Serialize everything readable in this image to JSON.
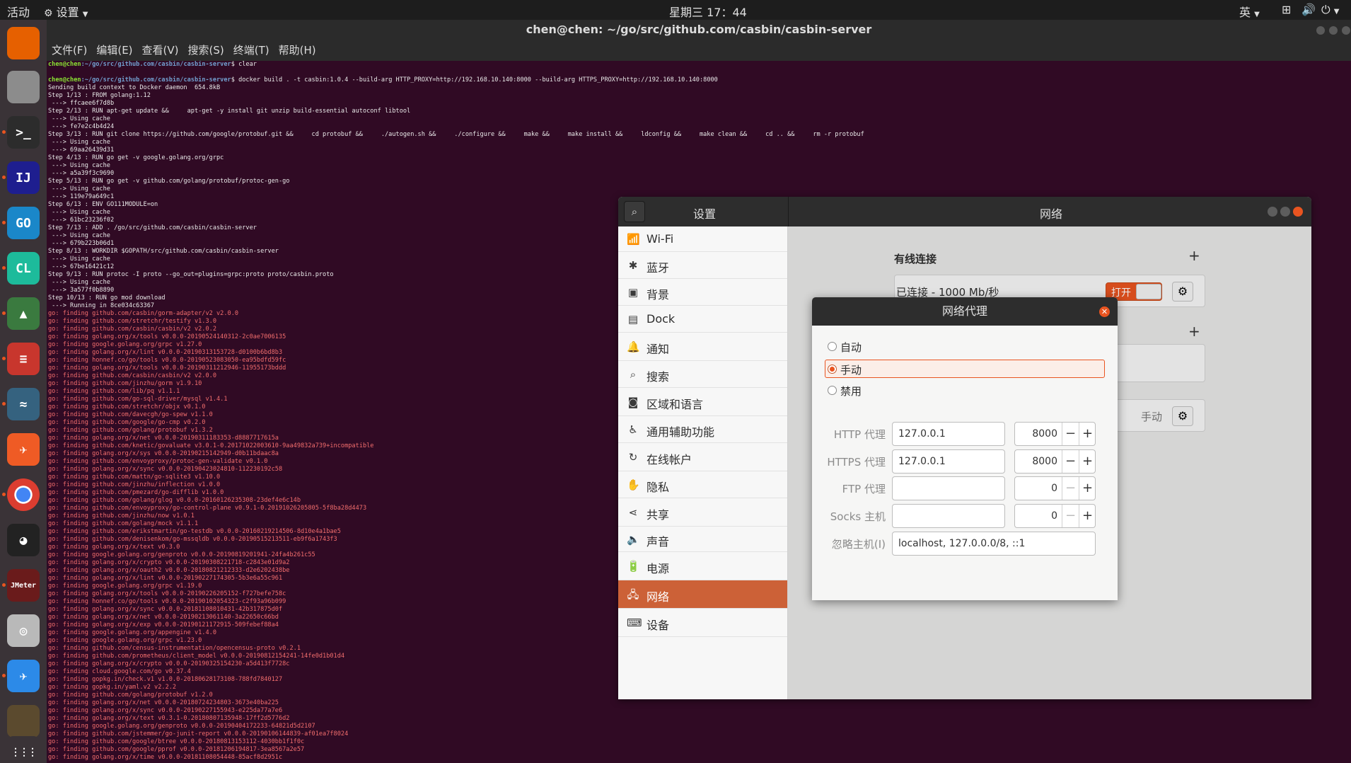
{
  "topbar": {
    "activities": "活动",
    "app": "设置",
    "clock": "星期三 17：44",
    "lang": "英"
  },
  "dock": {
    "items": [
      {
        "name": "firefox-icon",
        "color": "#e66000",
        "glyph": ""
      },
      {
        "name": "files-icon",
        "color": "#8c8c8c",
        "glyph": ""
      },
      {
        "name": "terminal-icon",
        "color": "#2c2c2c",
        "glyph": ">_"
      },
      {
        "name": "intellij-icon",
        "color": "#1e1e8f",
        "glyph": "IJ"
      },
      {
        "name": "goland-icon",
        "color": "#1a87c9",
        "glyph": "GO"
      },
      {
        "name": "clion-icon",
        "color": "#1dbb9b",
        "glyph": "CL"
      },
      {
        "name": "rocket-icon",
        "color": "#3a7a3f",
        "glyph": "▲"
      },
      {
        "name": "redis-icon",
        "color": "#c8362d",
        "glyph": "≡"
      },
      {
        "name": "mysql-workbench-icon",
        "color": "#35627f",
        "glyph": "≈"
      },
      {
        "name": "postman-icon",
        "color": "#ef5b25",
        "glyph": "✈"
      },
      {
        "name": "chrome-icon",
        "color": "#dc3d30",
        "glyph": "●"
      },
      {
        "name": "qq-icon",
        "color": "#222222",
        "glyph": "◕"
      },
      {
        "name": "jmeter-icon",
        "color": "#6a1b1b",
        "glyph": "JMeter"
      },
      {
        "name": "screenshot-icon",
        "color": "#b9b9b9",
        "glyph": "◎"
      },
      {
        "name": "deepin-icon",
        "color": "#2c8ae8",
        "glyph": "✈"
      },
      {
        "name": "notes-icon",
        "color": "#5b4a2e",
        "glyph": ""
      },
      {
        "name": "show-apps-icon",
        "color": "#3a3337",
        "glyph": "⋮⋮⋮"
      }
    ]
  },
  "terminal": {
    "title": "chen@chen: ~/go/src/github.com/casbin/casbin-server",
    "menu": [
      "文件(F)",
      "编辑(E)",
      "查看(V)",
      "搜索(S)",
      "终端(T)",
      "帮助(H)"
    ],
    "prompt_user": "chen@chen",
    "prompt_path": ":~/go/src/github.com/casbin/casbin-server",
    "lines": [
      {
        "t": "p",
        "cmd": "$ clear"
      },
      {
        "t": "b",
        "text": ""
      },
      {
        "t": "p",
        "cmd": "$ docker build . -t casbin:1.0.4 --build-arg HTTP_PROXY=http://192.168.10.140:8000 --build-arg HTTPS_PROXY=http://192.168.10.140:8000"
      },
      {
        "t": "n",
        "text": "Sending build context to Docker daemon  654.8kB"
      },
      {
        "t": "n",
        "text": "Step 1/13 : FROM golang:1.12"
      },
      {
        "t": "n",
        "text": " ---> ffcaee6f7d8b"
      },
      {
        "t": "n",
        "text": "Step 2/13 : RUN apt-get update &&     apt-get -y install git unzip build-essential autoconf libtool"
      },
      {
        "t": "n",
        "text": " ---> Using cache"
      },
      {
        "t": "n",
        "text": " ---> fe7e2c4b4d24"
      },
      {
        "t": "n",
        "text": "Step 3/13 : RUN git clone https://github.com/google/protobuf.git &&     cd protobuf &&     ./autogen.sh &&     ./configure &&     make &&     make install &&     ldconfig &&     make clean &&     cd .. &&     rm -r protobuf"
      },
      {
        "t": "n",
        "text": " ---> Using cache"
      },
      {
        "t": "n",
        "text": " ---> 69aa26439d31"
      },
      {
        "t": "n",
        "text": "Step 4/13 : RUN go get -v google.golang.org/grpc"
      },
      {
        "t": "n",
        "text": " ---> Using cache"
      },
      {
        "t": "n",
        "text": " ---> a5a39f3c9690"
      },
      {
        "t": "n",
        "text": "Step 5/13 : RUN go get -v github.com/golang/protobuf/protoc-gen-go"
      },
      {
        "t": "n",
        "text": " ---> Using cache"
      },
      {
        "t": "n",
        "text": " ---> 119e79a649c1"
      },
      {
        "t": "n",
        "text": "Step 6/13 : ENV GO111MODULE=on"
      },
      {
        "t": "n",
        "text": " ---> Using cache"
      },
      {
        "t": "n",
        "text": " ---> 61bc23236f02"
      },
      {
        "t": "n",
        "text": "Step 7/13 : ADD . /go/src/github.com/casbin/casbin-server"
      },
      {
        "t": "n",
        "text": " ---> Using cache"
      },
      {
        "t": "n",
        "text": " ---> 679b223b06d1"
      },
      {
        "t": "n",
        "text": "Step 8/13 : WORKDIR $GOPATH/src/github.com/casbin/casbin-server"
      },
      {
        "t": "n",
        "text": " ---> Using cache"
      },
      {
        "t": "n",
        "text": " ---> 67be16421c12"
      },
      {
        "t": "n",
        "text": "Step 9/13 : RUN protoc -I proto --go_out=plugins=grpc:proto proto/casbin.proto"
      },
      {
        "t": "n",
        "text": " ---> Using cache"
      },
      {
        "t": "n",
        "text": " ---> 3a577f0b8890"
      },
      {
        "t": "n",
        "text": "Step 10/13 : RUN go mod download"
      },
      {
        "t": "n",
        "text": " ---> Running in 8ce034c63367"
      },
      {
        "t": "g",
        "text": "go: finding github.com/casbin/gorm-adapter/v2 v2.0.0"
      },
      {
        "t": "g",
        "text": "go: finding github.com/stretchr/testify v1.3.0"
      },
      {
        "t": "g",
        "text": "go: finding github.com/casbin/casbin/v2 v2.0.2"
      },
      {
        "t": "g",
        "text": "go: finding golang.org/x/tools v0.0.0-20190524140312-2c0ae7006135"
      },
      {
        "t": "g",
        "text": "go: finding google.golang.org/grpc v1.27.0"
      },
      {
        "t": "g",
        "text": "go: finding golang.org/x/lint v0.0.0-20190313153728-d0100b6bd8b3"
      },
      {
        "t": "g",
        "text": "go: finding honnef.co/go/tools v0.0.0-20190523083050-ea95bdfd59fc"
      },
      {
        "t": "g",
        "text": "go: finding golang.org/x/tools v0.0.0-20190311212946-11955173bddd"
      },
      {
        "t": "g",
        "text": "go: finding github.com/casbin/casbin/v2 v2.0.0"
      },
      {
        "t": "g",
        "text": "go: finding github.com/jinzhu/gorm v1.9.10"
      },
      {
        "t": "g",
        "text": "go: finding github.com/lib/pq v1.1.1"
      },
      {
        "t": "g",
        "text": "go: finding github.com/go-sql-driver/mysql v1.4.1"
      },
      {
        "t": "g",
        "text": "go: finding github.com/stretchr/objx v0.1.0"
      },
      {
        "t": "g",
        "text": "go: finding github.com/davecgh/go-spew v1.1.0"
      },
      {
        "t": "g",
        "text": "go: finding github.com/google/go-cmp v0.2.0"
      },
      {
        "t": "g",
        "text": "go: finding github.com/golang/protobuf v1.3.2"
      },
      {
        "t": "g",
        "text": "go: finding golang.org/x/net v0.0.0-20190311183353-d8887717615a"
      },
      {
        "t": "g",
        "text": "go: finding github.com/knetic/govaluate v3.0.1-0.20171022003610-9aa49832a739+incompatible"
      },
      {
        "t": "g",
        "text": "go: finding golang.org/x/sys v0.0.0-20190215142949-d0b11bdaac8a"
      },
      {
        "t": "g",
        "text": "go: finding github.com/envoyproxy/protoc-gen-validate v0.1.0"
      },
      {
        "t": "g",
        "text": "go: finding golang.org/x/sync v0.0.0-20190423024810-112230192c58"
      },
      {
        "t": "g",
        "text": "go: finding github.com/mattn/go-sqlite3 v1.10.0"
      },
      {
        "t": "g",
        "text": "go: finding github.com/jinzhu/inflection v1.0.0"
      },
      {
        "t": "g",
        "text": "go: finding github.com/pmezard/go-difflib v1.0.0"
      },
      {
        "t": "g",
        "text": "go: finding github.com/golang/glog v0.0.0-20160126235308-23def4e6c14b"
      },
      {
        "t": "g",
        "text": "go: finding github.com/envoyproxy/go-control-plane v0.9.1-0.20191026205805-5f8ba28d4473"
      },
      {
        "t": "g",
        "text": "go: finding github.com/jinzhu/now v1.0.1"
      },
      {
        "t": "g",
        "text": "go: finding github.com/golang/mock v1.1.1"
      },
      {
        "t": "g",
        "text": "go: finding github.com/erikstmartin/go-testdb v0.0.0-20160219214506-8d10e4a1bae5"
      },
      {
        "t": "g",
        "text": "go: finding github.com/denisenkom/go-mssqldb v0.0.0-20190515213511-eb9f6a1743f3"
      },
      {
        "t": "g",
        "text": "go: finding golang.org/x/text v0.3.0"
      },
      {
        "t": "g",
        "text": "go: finding google.golang.org/genproto v0.0.0-20190819201941-24fa4b261c55"
      },
      {
        "t": "g",
        "text": "go: finding golang.org/x/crypto v0.0.0-20190308221718-c2843e01d9a2"
      },
      {
        "t": "g",
        "text": "go: finding golang.org/x/oauth2 v0.0.0-20180821212333-d2e6202438be"
      },
      {
        "t": "g",
        "text": "go: finding golang.org/x/lint v0.0.0-20190227174305-5b3e6a55c961"
      },
      {
        "t": "g",
        "text": "go: finding google.golang.org/grpc v1.19.0"
      },
      {
        "t": "g",
        "text": "go: finding golang.org/x/tools v0.0.0-20190226205152-f727befe758c"
      },
      {
        "t": "g",
        "text": "go: finding honnef.co/go/tools v0.0.0-20190102054323-c2f93a96b099"
      },
      {
        "t": "g",
        "text": "go: finding golang.org/x/sync v0.0.0-20181108010431-42b317875d0f"
      },
      {
        "t": "g",
        "text": "go: finding golang.org/x/net v0.0.0-20190213061140-3a22650c66bd"
      },
      {
        "t": "g",
        "text": "go: finding golang.org/x/exp v0.0.0-20190121172915-509febef88a4"
      },
      {
        "t": "g",
        "text": "go: finding google.golang.org/appengine v1.4.0"
      },
      {
        "t": "g",
        "text": "go: finding google.golang.org/grpc v1.23.0"
      },
      {
        "t": "g",
        "text": "go: finding github.com/census-instrumentation/opencensus-proto v0.2.1"
      },
      {
        "t": "g",
        "text": "go: finding github.com/prometheus/client_model v0.0.0-20190812154241-14fe0d1b01d4"
      },
      {
        "t": "g",
        "text": "go: finding golang.org/x/crypto v0.0.0-20190325154230-a5d413f7728c"
      },
      {
        "t": "g",
        "text": "go: finding cloud.google.com/go v0.37.4"
      },
      {
        "t": "g",
        "text": "go: finding gopkg.in/check.v1 v1.0.0-20180628173108-788fd7840127"
      },
      {
        "t": "g",
        "text": "go: finding gopkg.in/yaml.v2 v2.2.2"
      },
      {
        "t": "g",
        "text": "go: finding github.com/golang/protobuf v1.2.0"
      },
      {
        "t": "g",
        "text": "go: finding golang.org/x/net v0.0.0-20180724234803-3673e40ba225"
      },
      {
        "t": "g",
        "text": "go: finding golang.org/x/sync v0.0.0-20190227155943-e225da77a7e6"
      },
      {
        "t": "g",
        "text": "go: finding golang.org/x/text v0.3.1-0.20180807135948-17ff2d5776d2"
      },
      {
        "t": "g",
        "text": "go: finding google.golang.org/genproto v0.0.0-20190404172233-64821d5d2107"
      },
      {
        "t": "g",
        "text": "go: finding github.com/jstemmer/go-junit-report v0.0.0-20190106144839-af01ea7f8024"
      },
      {
        "t": "g",
        "text": "go: finding github.com/google/btree v0.0.0-20180813153112-4030bb1f1f0c"
      },
      {
        "t": "g",
        "text": "go: finding github.com/google/pprof v0.0.0-20181206194817-3ea8567a2e57"
      },
      {
        "t": "g",
        "text": "go: finding golang.org/x/time v0.0.0-20181108054448-85acf8d2951c"
      }
    ]
  },
  "settings": {
    "title": "设置",
    "panel_title": "网络",
    "sidebar": [
      {
        "label": "Wi-Fi",
        "icon": "wifi-icon",
        "glyph": "📶",
        "selected": false
      },
      {
        "label": "蓝牙",
        "icon": "bluetooth-icon",
        "glyph": "✱",
        "selected": false
      },
      {
        "label": "背景",
        "icon": "background-icon",
        "glyph": "▣",
        "selected": false
      },
      {
        "label": "Dock",
        "icon": "dock-icon",
        "glyph": "▤",
        "selected": false
      },
      {
        "label": "通知",
        "icon": "bell-icon",
        "glyph": "🔔",
        "selected": false
      },
      {
        "label": "搜索",
        "icon": "search-icon",
        "glyph": "⌕",
        "selected": false
      },
      {
        "label": "区域和语言",
        "icon": "camera-icon",
        "glyph": "◙",
        "selected": false
      },
      {
        "label": "通用辅助功能",
        "icon": "accessibility-icon",
        "glyph": "♿",
        "selected": false
      },
      {
        "label": "在线帐户",
        "icon": "online-accounts-icon",
        "glyph": "↻",
        "selected": false
      },
      {
        "label": "隐私",
        "icon": "hand-icon",
        "glyph": "✋",
        "selected": false
      },
      {
        "label": "共享",
        "icon": "share-icon",
        "glyph": "⋖",
        "selected": false
      },
      {
        "label": "声音",
        "icon": "speaker-icon",
        "glyph": "🔈",
        "selected": false
      },
      {
        "label": "电源",
        "icon": "power-icon",
        "glyph": "🔋",
        "selected": false
      },
      {
        "label": "网络",
        "icon": "network-icon",
        "glyph": "🖧",
        "selected": true
      },
      {
        "label": "设备",
        "icon": "devices-icon",
        "glyph": "⌨",
        "selected": false
      }
    ],
    "wired": {
      "title": "有线连接",
      "status": "已连接 - 1000 Mb/秒",
      "toggle": "打开"
    },
    "proxy_mode": "手动"
  },
  "proxy_dialog": {
    "title": "网络代理",
    "modes": [
      {
        "label": "自动",
        "selected": false
      },
      {
        "label": "手动",
        "selected": true
      },
      {
        "label": "禁用",
        "selected": false
      }
    ],
    "rows": [
      {
        "label": "HTTP 代理",
        "host": "127.0.0.1",
        "port": "8000"
      },
      {
        "label": "HTTPS 代理",
        "host": "127.0.0.1",
        "port": "8000"
      },
      {
        "label": "FTP 代理",
        "host": "",
        "port": "0"
      },
      {
        "label": "Socks 主机",
        "host": "",
        "port": "0"
      }
    ],
    "ignore_label": "忽略主机(I)",
    "ignore_hosts": "localhost, 127.0.0.0/8, ::1"
  },
  "colors": {
    "accent": "#e95420",
    "terminal_bg": "#300a24",
    "selected": "#cc6137"
  }
}
